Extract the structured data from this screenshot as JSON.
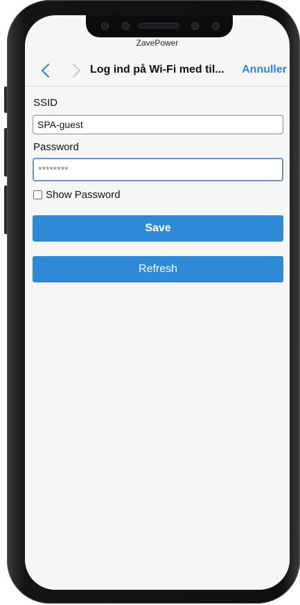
{
  "app": {
    "title": "ZavePower"
  },
  "navbar": {
    "back_icon": "chevron-left-icon",
    "forward_icon": "chevron-right-icon",
    "title": "Log ind på Wi-Fi med til...",
    "cancel_label": "Annuller"
  },
  "form": {
    "ssid_label": "SSID",
    "ssid_value": "SPA-guest",
    "password_label": "Password",
    "password_placeholder": "********",
    "show_password_label": "Show Password",
    "show_password_checked": false
  },
  "buttons": {
    "save_label": "Save",
    "refresh_label": "Refresh"
  },
  "colors": {
    "accent": "#2e8ad6",
    "link": "#2f86cf",
    "background": "#f6f6f7"
  }
}
